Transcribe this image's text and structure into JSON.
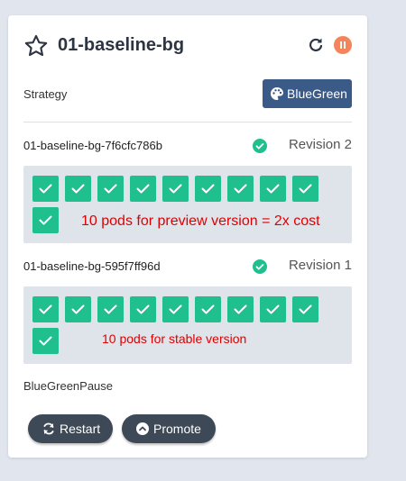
{
  "rollout": {
    "title": "01-baseline-bg",
    "strategy_label": "Strategy",
    "strategy_value": "BlueGreen"
  },
  "revisions": [
    {
      "name": "01-baseline-bg-7f6cfc786b",
      "label": "Revision 2",
      "pod_count": 10,
      "note": "10 pods for preview version = 2x cost"
    },
    {
      "name": "01-baseline-bg-595f7ff96d",
      "label": "Revision 1",
      "pod_count": 10,
      "note": "10 pods for stable version"
    }
  ],
  "pause_condition": "BlueGreenPause",
  "actions": {
    "restart_label": "Restart",
    "promote_label": "Promote"
  },
  "colors": {
    "pod_healthy": "#20bf8e",
    "strategy_badge": "#3a5a88",
    "button": "#3e4957",
    "pause_indicator": "#f3845c",
    "note_text": "#e00000"
  },
  "icons": {
    "favorite": "star-outline-icon",
    "reload": "refresh-icon",
    "status": "pause-icon",
    "strategy": "palette-icon",
    "pod": "check-icon",
    "revision_status": "check-circle-icon",
    "restart": "sync-icon",
    "promote": "chevron-up-circle-icon"
  }
}
